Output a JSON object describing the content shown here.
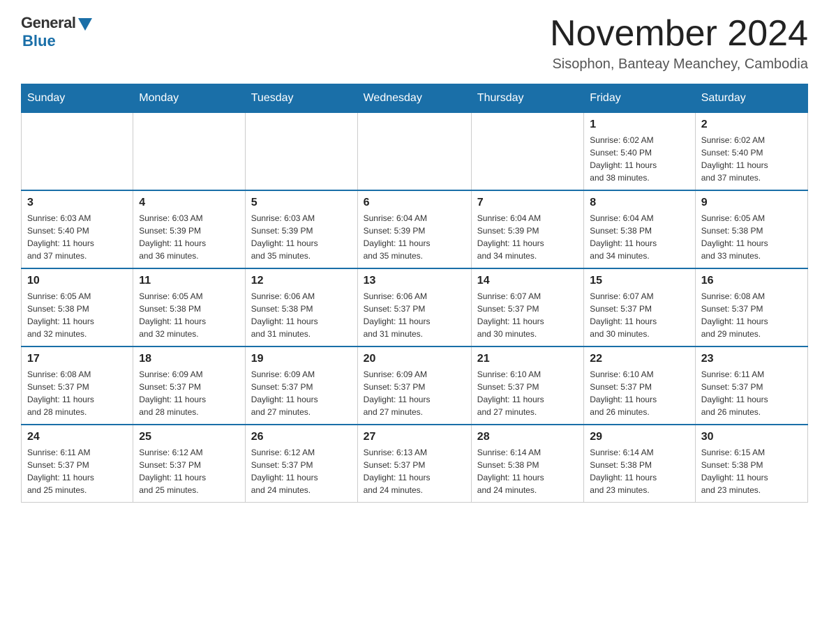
{
  "logo": {
    "general": "General",
    "blue": "Blue"
  },
  "title": "November 2024",
  "subtitle": "Sisophon, Banteay Meanchey, Cambodia",
  "days_of_week": [
    "Sunday",
    "Monday",
    "Tuesday",
    "Wednesday",
    "Thursday",
    "Friday",
    "Saturday"
  ],
  "weeks": [
    [
      {
        "day": "",
        "info": ""
      },
      {
        "day": "",
        "info": ""
      },
      {
        "day": "",
        "info": ""
      },
      {
        "day": "",
        "info": ""
      },
      {
        "day": "",
        "info": ""
      },
      {
        "day": "1",
        "info": "Sunrise: 6:02 AM\nSunset: 5:40 PM\nDaylight: 11 hours\nand 38 minutes."
      },
      {
        "day": "2",
        "info": "Sunrise: 6:02 AM\nSunset: 5:40 PM\nDaylight: 11 hours\nand 37 minutes."
      }
    ],
    [
      {
        "day": "3",
        "info": "Sunrise: 6:03 AM\nSunset: 5:40 PM\nDaylight: 11 hours\nand 37 minutes."
      },
      {
        "day": "4",
        "info": "Sunrise: 6:03 AM\nSunset: 5:39 PM\nDaylight: 11 hours\nand 36 minutes."
      },
      {
        "day": "5",
        "info": "Sunrise: 6:03 AM\nSunset: 5:39 PM\nDaylight: 11 hours\nand 35 minutes."
      },
      {
        "day": "6",
        "info": "Sunrise: 6:04 AM\nSunset: 5:39 PM\nDaylight: 11 hours\nand 35 minutes."
      },
      {
        "day": "7",
        "info": "Sunrise: 6:04 AM\nSunset: 5:39 PM\nDaylight: 11 hours\nand 34 minutes."
      },
      {
        "day": "8",
        "info": "Sunrise: 6:04 AM\nSunset: 5:38 PM\nDaylight: 11 hours\nand 34 minutes."
      },
      {
        "day": "9",
        "info": "Sunrise: 6:05 AM\nSunset: 5:38 PM\nDaylight: 11 hours\nand 33 minutes."
      }
    ],
    [
      {
        "day": "10",
        "info": "Sunrise: 6:05 AM\nSunset: 5:38 PM\nDaylight: 11 hours\nand 32 minutes."
      },
      {
        "day": "11",
        "info": "Sunrise: 6:05 AM\nSunset: 5:38 PM\nDaylight: 11 hours\nand 32 minutes."
      },
      {
        "day": "12",
        "info": "Sunrise: 6:06 AM\nSunset: 5:38 PM\nDaylight: 11 hours\nand 31 minutes."
      },
      {
        "day": "13",
        "info": "Sunrise: 6:06 AM\nSunset: 5:37 PM\nDaylight: 11 hours\nand 31 minutes."
      },
      {
        "day": "14",
        "info": "Sunrise: 6:07 AM\nSunset: 5:37 PM\nDaylight: 11 hours\nand 30 minutes."
      },
      {
        "day": "15",
        "info": "Sunrise: 6:07 AM\nSunset: 5:37 PM\nDaylight: 11 hours\nand 30 minutes."
      },
      {
        "day": "16",
        "info": "Sunrise: 6:08 AM\nSunset: 5:37 PM\nDaylight: 11 hours\nand 29 minutes."
      }
    ],
    [
      {
        "day": "17",
        "info": "Sunrise: 6:08 AM\nSunset: 5:37 PM\nDaylight: 11 hours\nand 28 minutes."
      },
      {
        "day": "18",
        "info": "Sunrise: 6:09 AM\nSunset: 5:37 PM\nDaylight: 11 hours\nand 28 minutes."
      },
      {
        "day": "19",
        "info": "Sunrise: 6:09 AM\nSunset: 5:37 PM\nDaylight: 11 hours\nand 27 minutes."
      },
      {
        "day": "20",
        "info": "Sunrise: 6:09 AM\nSunset: 5:37 PM\nDaylight: 11 hours\nand 27 minutes."
      },
      {
        "day": "21",
        "info": "Sunrise: 6:10 AM\nSunset: 5:37 PM\nDaylight: 11 hours\nand 27 minutes."
      },
      {
        "day": "22",
        "info": "Sunrise: 6:10 AM\nSunset: 5:37 PM\nDaylight: 11 hours\nand 26 minutes."
      },
      {
        "day": "23",
        "info": "Sunrise: 6:11 AM\nSunset: 5:37 PM\nDaylight: 11 hours\nand 26 minutes."
      }
    ],
    [
      {
        "day": "24",
        "info": "Sunrise: 6:11 AM\nSunset: 5:37 PM\nDaylight: 11 hours\nand 25 minutes."
      },
      {
        "day": "25",
        "info": "Sunrise: 6:12 AM\nSunset: 5:37 PM\nDaylight: 11 hours\nand 25 minutes."
      },
      {
        "day": "26",
        "info": "Sunrise: 6:12 AM\nSunset: 5:37 PM\nDaylight: 11 hours\nand 24 minutes."
      },
      {
        "day": "27",
        "info": "Sunrise: 6:13 AM\nSunset: 5:37 PM\nDaylight: 11 hours\nand 24 minutes."
      },
      {
        "day": "28",
        "info": "Sunrise: 6:14 AM\nSunset: 5:38 PM\nDaylight: 11 hours\nand 24 minutes."
      },
      {
        "day": "29",
        "info": "Sunrise: 6:14 AM\nSunset: 5:38 PM\nDaylight: 11 hours\nand 23 minutes."
      },
      {
        "day": "30",
        "info": "Sunrise: 6:15 AM\nSunset: 5:38 PM\nDaylight: 11 hours\nand 23 minutes."
      }
    ]
  ]
}
